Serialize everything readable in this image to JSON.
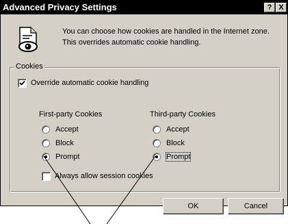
{
  "window": {
    "title": "Advanced Privacy Settings",
    "help_glyph": "?",
    "close_glyph": "X"
  },
  "intro_text": "You can choose how cookies are handled in the Internet zone.  This overrides automatic cookie handling.",
  "cookies_group": {
    "legend": "Cookies",
    "override": {
      "label": "Override automatic cookie handling",
      "checked": true
    },
    "first_party": {
      "heading": "First-party Cookies",
      "options": [
        "Accept",
        "Block",
        "Prompt"
      ],
      "selected": "Prompt"
    },
    "third_party": {
      "heading": "Third-party Cookies",
      "options": [
        "Accept",
        "Block",
        "Prompt"
      ],
      "selected": "Prompt"
    },
    "session": {
      "label": "Always allow session cookies",
      "checked": false
    }
  },
  "buttons": {
    "ok": "OK",
    "cancel": "Cancel"
  },
  "icons": {
    "dialog": "privacy-settings-icon",
    "checkmark": "checkmark-icon"
  },
  "colors": {
    "titlebar": "#000000",
    "face": "#d4d0c8",
    "annotation_line": "#000000"
  }
}
